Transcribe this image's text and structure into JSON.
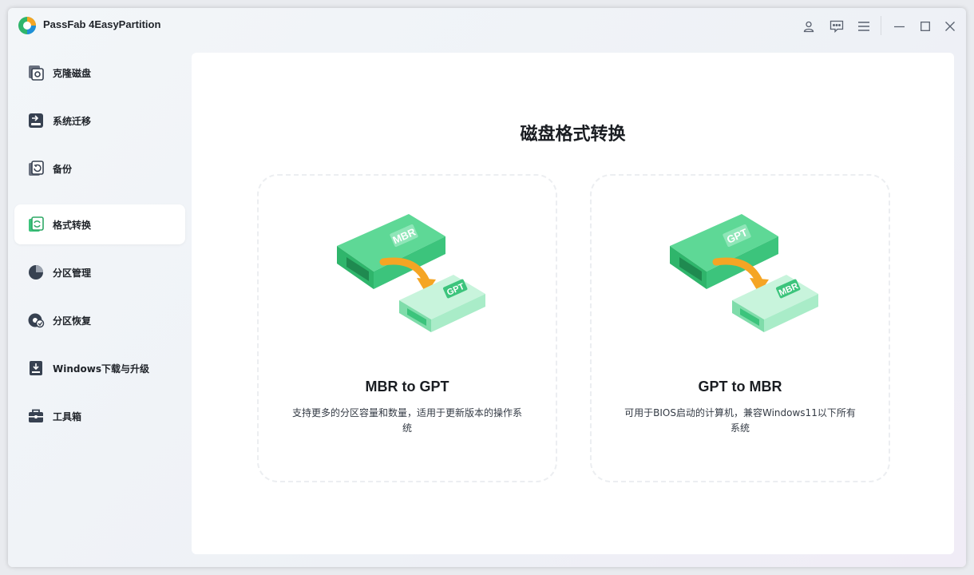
{
  "app": {
    "title": "PassFab 4EasyPartition"
  },
  "sidebar": {
    "items": [
      {
        "label": "克隆磁盘",
        "icon": "clone-disk-icon"
      },
      {
        "label": "系统迁移",
        "icon": "system-migrate-icon"
      },
      {
        "label": "备份",
        "icon": "backup-icon"
      },
      {
        "label": "格式转换",
        "icon": "convert-format-icon",
        "active": true
      },
      {
        "label": "分区管理",
        "icon": "partition-manage-icon"
      },
      {
        "label": "分区恢复",
        "icon": "partition-recovery-icon"
      },
      {
        "label": "Windows下载与升级",
        "icon": "windows-download-icon"
      },
      {
        "label": "工具箱",
        "icon": "toolbox-icon"
      }
    ]
  },
  "main": {
    "title": "磁盘格式转换",
    "cards": [
      {
        "title": "MBR to GPT",
        "description": "支持更多的分区容量和数量，适用于更新版本的操作系统",
        "source_label": "MBR",
        "target_label": "GPT"
      },
      {
        "title": "GPT to MBR",
        "description": "可用于BIOS启动的计算机，兼容Windows11以下所有系统",
        "source_label": "GPT",
        "target_label": "MBR"
      }
    ]
  },
  "colors": {
    "accent": "#3cc47c",
    "accent_light": "#8ee6b6",
    "arrow": "#f5a524"
  }
}
